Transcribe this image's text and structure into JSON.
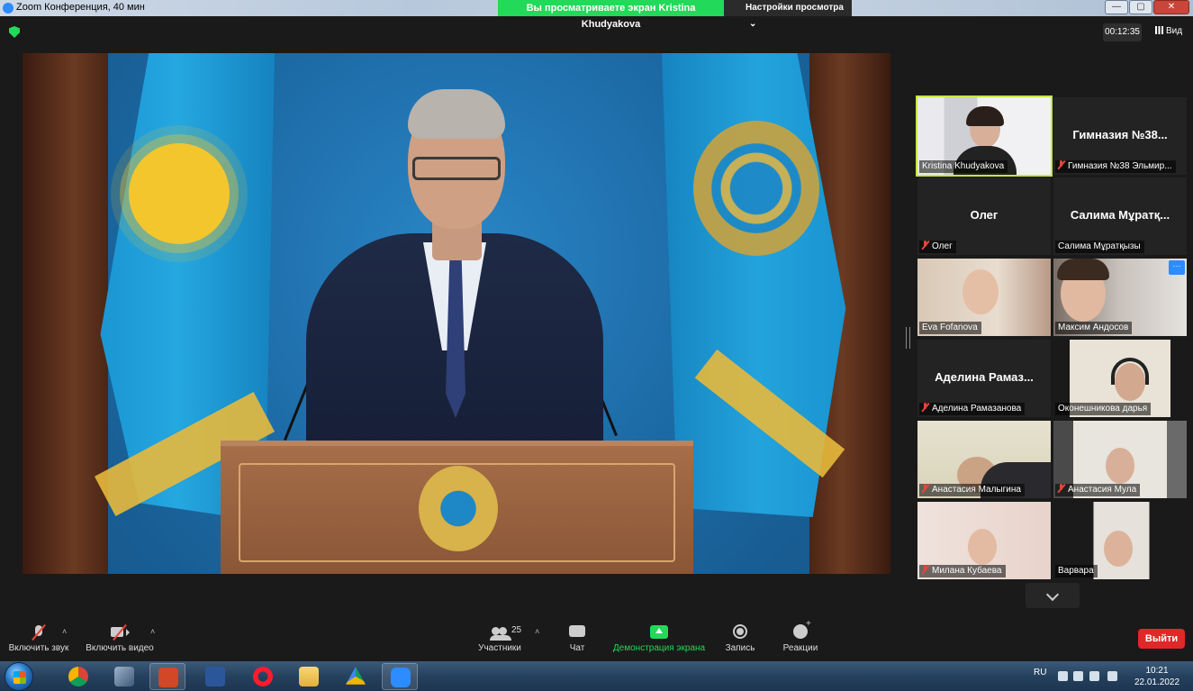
{
  "window": {
    "title": "Zoom Конференция, 40 мин",
    "share_banner": "Вы просматриваете экран Kristina Khudyakova",
    "view_settings": "Настройки просмотра",
    "view_settings_caret": "⌄",
    "buttons": {
      "minimize": "—",
      "maximize": "▢",
      "close": "✕"
    }
  },
  "meeting": {
    "timer": "00:12:35",
    "view_label": "Вид"
  },
  "gallery": {
    "tiles": [
      {
        "label": "Kristina Khudyakova",
        "big_name": "",
        "muted": false,
        "video": true,
        "active": true
      },
      {
        "label": "Гимназия №38 Эльмир...",
        "big_name": "Гимназия №38...",
        "muted": true,
        "video": false,
        "active": false
      },
      {
        "label": "Олег",
        "big_name": "Олег",
        "muted": true,
        "video": false,
        "active": false
      },
      {
        "label": "Салима Мұратқызы",
        "big_name": "Салима Мұратқ...",
        "muted": false,
        "video": false,
        "active": false
      },
      {
        "label": "Eva Fofanova",
        "big_name": "",
        "muted": false,
        "video": true,
        "active": false
      },
      {
        "label": "Максим Андосов",
        "big_name": "",
        "muted": false,
        "video": true,
        "active": false,
        "more": "···"
      },
      {
        "label": "Аделина Рамазанова",
        "big_name": "Аделина Рамаз...",
        "muted": true,
        "video": false,
        "active": false
      },
      {
        "label": "Оконешникова дарья",
        "big_name": "",
        "muted": false,
        "video": true,
        "active": false
      },
      {
        "label": "Анастасия Малыгина",
        "big_name": "",
        "muted": true,
        "video": true,
        "active": false
      },
      {
        "label": "Анастасия Мула",
        "big_name": "",
        "muted": true,
        "video": true,
        "active": false
      },
      {
        "label": "Милана Кубаева",
        "big_name": "",
        "muted": true,
        "video": true,
        "active": false
      },
      {
        "label": "Варвара",
        "big_name": "",
        "muted": false,
        "video": true,
        "active": false
      }
    ]
  },
  "toolbar": {
    "unmute": "Включить звук",
    "start_video": "Включить видео",
    "participants": "Участники",
    "participants_count": "25",
    "chat": "Чат",
    "share_screen": "Демонстрация экрана",
    "record": "Запись",
    "reactions": "Реакции",
    "leave": "Выйти",
    "caret": "˄"
  },
  "taskbar": {
    "language": "RU",
    "time": "10:21",
    "date": "22.01.2022",
    "apps": [
      "chrome-icon",
      "settings-icon",
      "powerpoint-icon",
      "word-icon",
      "opera-icon",
      "explorer-icon",
      "drive-icon",
      "zoom-icon"
    ]
  },
  "colors": {
    "share_green": "#23d959",
    "active_outline": "#c7e83f",
    "leave_red": "#e02828",
    "muted_red": "#e8443a",
    "zoom_blue": "#2d8cff"
  }
}
